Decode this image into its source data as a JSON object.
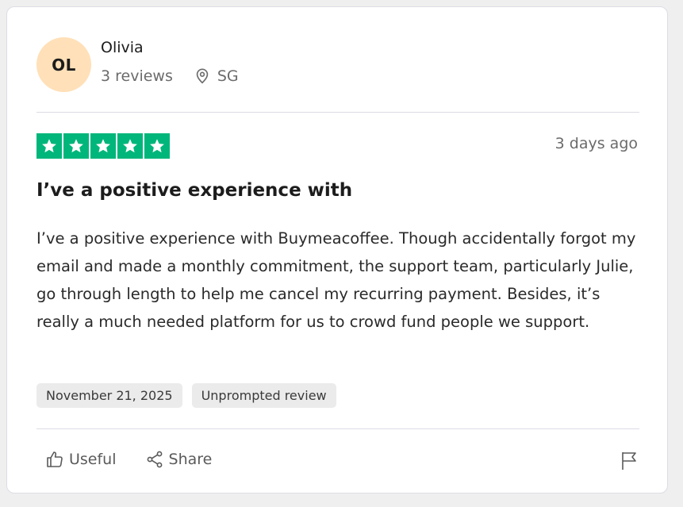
{
  "reviewer": {
    "initials": "OL",
    "name": "Olivia",
    "reviews_count": "3 reviews",
    "location": "SG",
    "avatar_color": "#ffe0b8"
  },
  "review": {
    "rating": 5,
    "max_rating": 5,
    "star_color": "#00b67a",
    "time_ago": "3 days ago",
    "title": "I’ve a positive experience with",
    "body": "I’ve a positive experience with Buymeacoffee. Though accidentally forgot my email and made a monthly commitment, the support team, particularly Julie, go through length to help me cancel my recurring payment. Besides, it’s really a much needed platform for us to crowd fund people we support.",
    "tags": [
      "November 21, 2025",
      "Unprompted review"
    ]
  },
  "actions": {
    "useful_label": "Useful",
    "share_label": "Share",
    "icons": [
      "thumbs-up-icon",
      "share-icon",
      "flag-icon"
    ]
  }
}
